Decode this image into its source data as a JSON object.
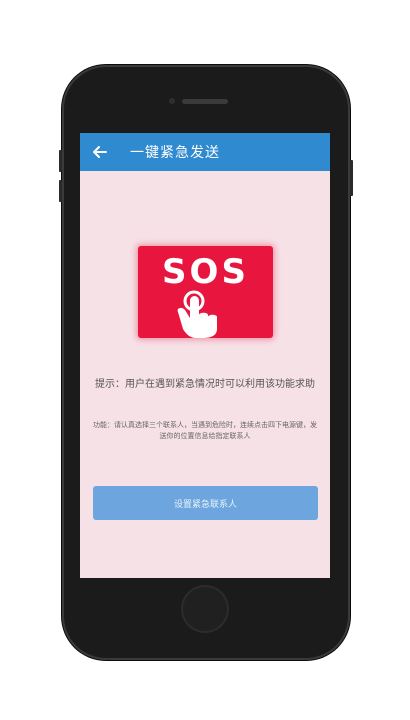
{
  "app": {
    "title": "一键紧急发送"
  },
  "sos": {
    "label": "SOS",
    "colors": {
      "card": "#e8163f",
      "hand": "#ffffff"
    }
  },
  "content": {
    "hint": "提示：用户在遇到紧急情况时可以利用该功能求助",
    "function_desc": "功能：请认真选择三个联系人，当遇到危险时，连续点击四下电源键，发送你的位置信息给指定联系人"
  },
  "actions": {
    "set_contacts_label": "设置紧急联系人"
  },
  "theme": {
    "appbar": "#2f8ad0",
    "background": "#f6e1e6",
    "button": "#6da5de"
  }
}
